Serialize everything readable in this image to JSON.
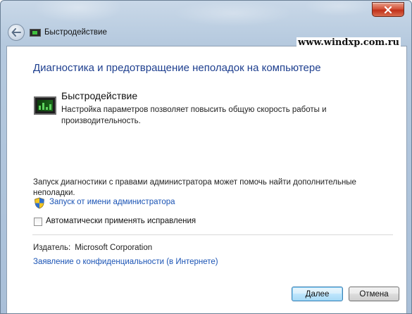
{
  "window": {
    "title": "Быстродействие",
    "breadcrumb": "Быстродействие",
    "watermark": "www.windxp.com.ru"
  },
  "main": {
    "heading": "Диагностика и предотвращение неполадок на компьютере",
    "task_name": "Быстродействие",
    "task_description": "Настройка параметров позволяет повысить общую скорость работы и производительность.",
    "admin_note": "Запуск диагностики с правами администратора может помочь найти дополнительные неполадки.",
    "admin_link": "Запуск от имени администратора",
    "auto_fix_label": "Автоматически применять исправления",
    "auto_fix_checked": false,
    "publisher_label": "Издатель:",
    "publisher_value": "Microsoft Corporation",
    "privacy_link": "Заявление о конфиденциальности (в Интернете)"
  },
  "buttons": {
    "next": "Далее",
    "cancel": "Отмена"
  },
  "icons": {
    "back": "back-arrow-icon",
    "close": "close-icon",
    "shield": "uac-shield-icon",
    "performance": "performance-monitor-icon"
  }
}
